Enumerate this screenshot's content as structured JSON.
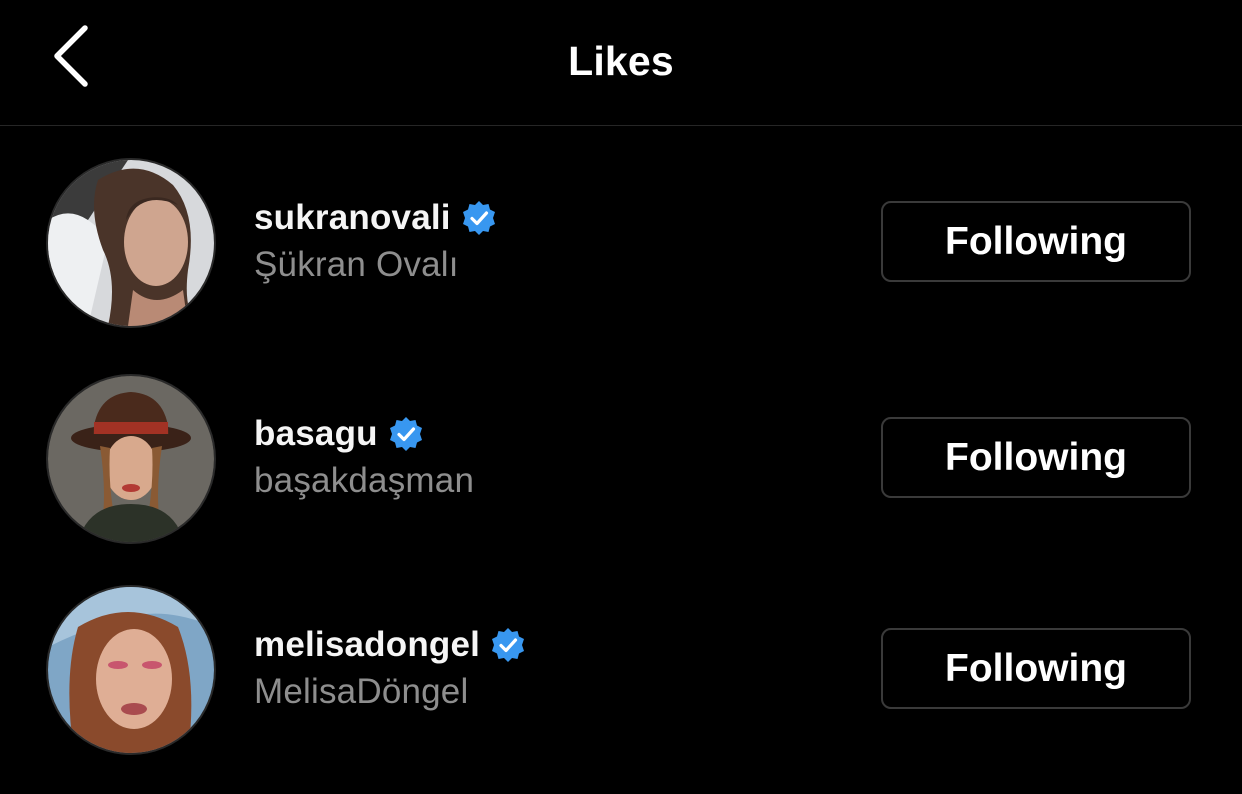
{
  "header": {
    "title": "Likes",
    "back_icon": "chevron-left-icon"
  },
  "likes": [
    {
      "username": "sukranovali",
      "full_name": "Şükran Ovalı",
      "verified": true,
      "button_label": "Following"
    },
    {
      "username": "basagu",
      "full_name": "başakdaşman",
      "verified": true,
      "button_label": "Following"
    },
    {
      "username": "melisadongel",
      "full_name": "MelisaDöngel",
      "verified": true,
      "button_label": "Following"
    }
  ],
  "colors": {
    "background": "#000000",
    "primary_text": "#ffffff",
    "secondary_text": "#8e8e8e",
    "verified_badge": "#3897f0",
    "button_border": "#3a3a3a"
  }
}
